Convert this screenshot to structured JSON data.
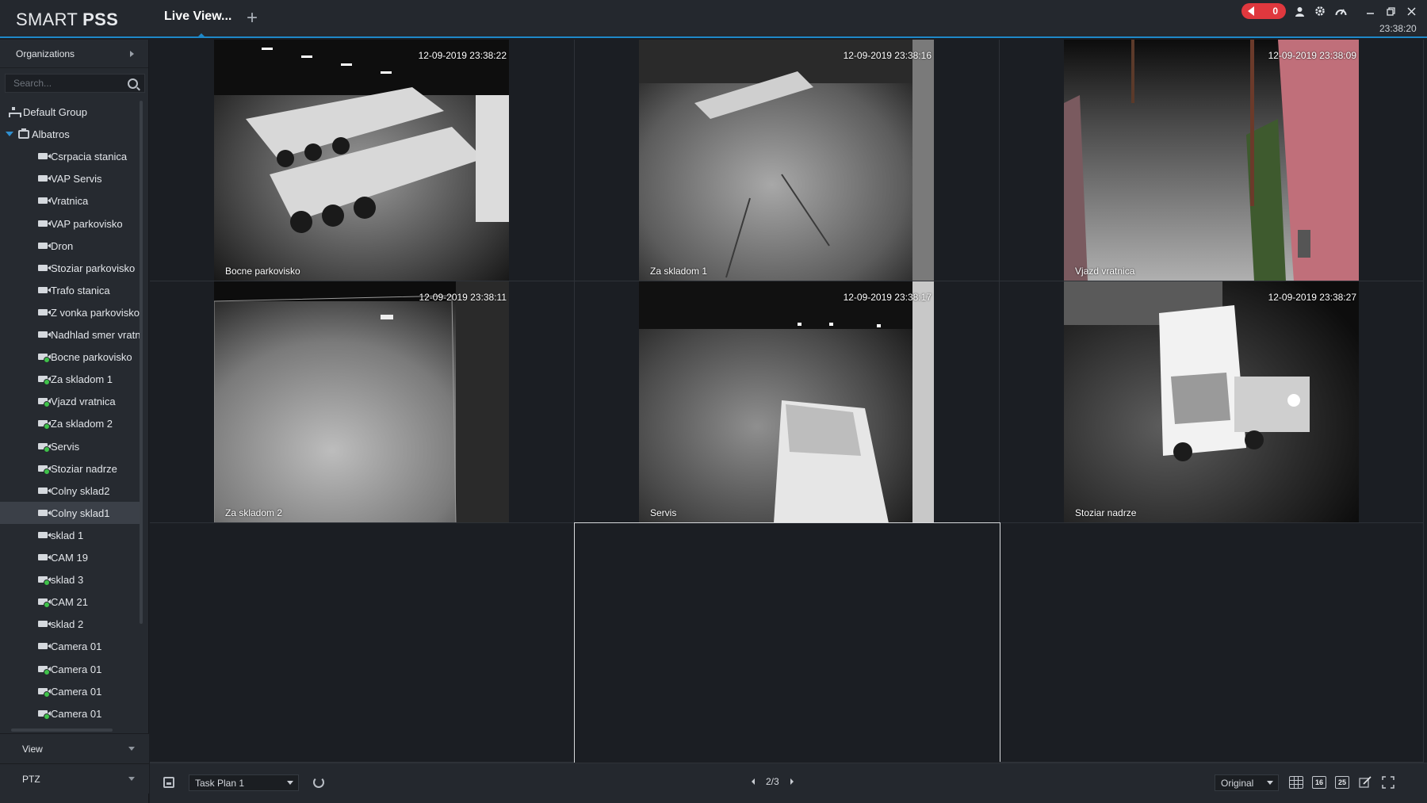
{
  "app": {
    "brand_light": "SMART ",
    "brand_bold": "PSS",
    "tab_title": "Live View...",
    "add_tab": "+",
    "clock": "23:38:20",
    "alarm_count": "0"
  },
  "sidebar": {
    "organizations": "Organizations",
    "search_placeholder": "Search...",
    "tree": [
      {
        "label": "Default Group",
        "type": "group"
      },
      {
        "label": "Albatros",
        "type": "device"
      },
      {
        "label": "Csrpacia stanica",
        "type": "camera",
        "online": false
      },
      {
        "label": "VAP Servis",
        "type": "camera",
        "online": false
      },
      {
        "label": "Vratnica",
        "type": "camera",
        "online": false
      },
      {
        "label": "VAP parkovisko",
        "type": "camera",
        "online": false
      },
      {
        "label": "Dron",
        "type": "camera",
        "online": false
      },
      {
        "label": "Stoziar parkovisko",
        "type": "camera",
        "online": false
      },
      {
        "label": "Trafo stanica",
        "type": "camera",
        "online": false
      },
      {
        "label": "Z vonka parkovisko",
        "type": "camera",
        "online": false
      },
      {
        "label": "Nadhlad smer vratnica",
        "type": "camera",
        "online": false
      },
      {
        "label": "Bocne parkovisko",
        "type": "camera",
        "online": true
      },
      {
        "label": "Za skladom 1",
        "type": "camera",
        "online": true
      },
      {
        "label": "Vjazd vratnica",
        "type": "camera",
        "online": true
      },
      {
        "label": "Za skladom 2",
        "type": "camera",
        "online": true
      },
      {
        "label": "Servis",
        "type": "camera",
        "online": true
      },
      {
        "label": "Stoziar nadrze",
        "type": "camera",
        "online": true
      },
      {
        "label": "Colny sklad2",
        "type": "camera",
        "online": false
      },
      {
        "label": "Colny sklad1",
        "type": "camera",
        "online": false,
        "selected": true
      },
      {
        "label": "sklad 1",
        "type": "camera",
        "online": false
      },
      {
        "label": "CAM 19",
        "type": "camera",
        "online": false
      },
      {
        "label": "sklad 3",
        "type": "camera",
        "online": true
      },
      {
        "label": "CAM 21",
        "type": "camera",
        "online": true
      },
      {
        "label": "sklad 2",
        "type": "camera",
        "online": false
      },
      {
        "label": "Camera 01",
        "type": "camera",
        "online": false
      },
      {
        "label": "Camera 01",
        "type": "camera",
        "online": true
      },
      {
        "label": "Camera 01",
        "type": "camera",
        "online": true
      },
      {
        "label": "Camera 01",
        "type": "camera",
        "online": true
      }
    ],
    "view_label": "View",
    "ptz_label": "PTZ"
  },
  "feeds": [
    {
      "name": "Bocne parkovisko",
      "timestamp": "12-09-2019 23:38:22",
      "scene": "trailers"
    },
    {
      "name": "Za skladom 1",
      "timestamp": "12-09-2019 23:38:16",
      "scene": "yard"
    },
    {
      "name": "Vjazd vratnica",
      "timestamp": "12-09-2019 23:38:09",
      "scene": "entrance"
    },
    {
      "name": "Za skladom 2",
      "timestamp": "12-09-2019 23:38:11",
      "scene": "lot"
    },
    {
      "name": "Servis",
      "timestamp": "12-09-2019 23:38:17",
      "scene": "van"
    },
    {
      "name": "Stoziar nadrze",
      "timestamp": "12-09-2019 23:38:27",
      "scene": "truck"
    }
  ],
  "bottombar": {
    "task_plan": "Task Plan 1",
    "page": "2/3",
    "ratio": "Original",
    "layout_16": "16",
    "layout_25": "25"
  },
  "colors": {
    "accent": "#1e88c8",
    "alarm": "#e0383e",
    "online": "#3fc24a"
  },
  "icons": [
    "speaker-icon",
    "user-icon",
    "gear-icon",
    "gauge-icon",
    "minimize-icon",
    "restore-icon",
    "close-icon",
    "search-icon",
    "save-icon",
    "refresh-icon",
    "grid-9-icon",
    "edit-icon",
    "fullscreen-icon"
  ]
}
